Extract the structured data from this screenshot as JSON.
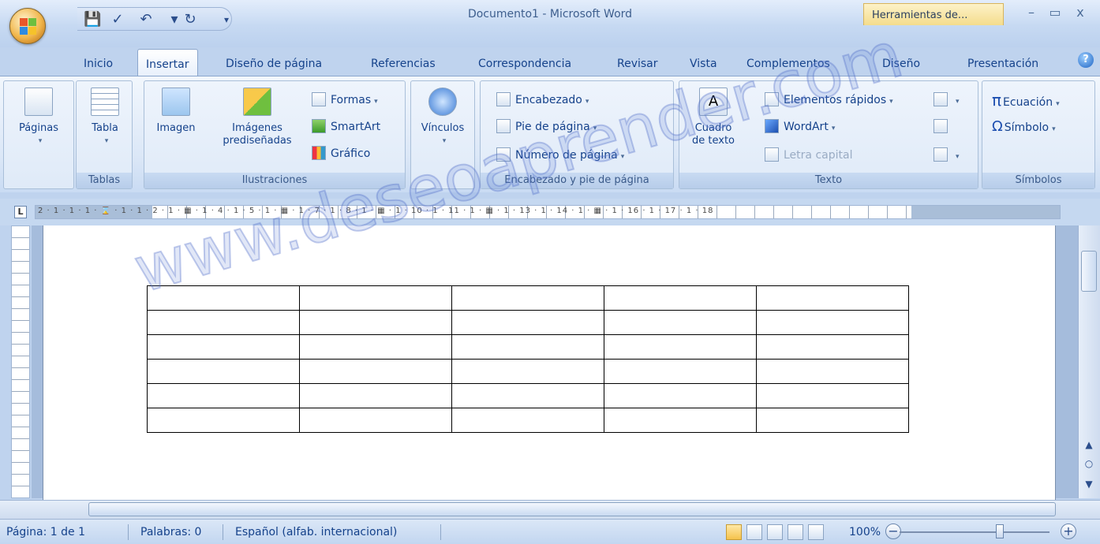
{
  "window": {
    "title": "Documento1 - Microsoft Word",
    "context_tab": "Herramientas de...",
    "controls": {
      "minimize": "–",
      "maximize": "▭",
      "close": "x"
    }
  },
  "qat": {
    "icons": [
      "save-icon",
      "spelling-icon",
      "undo-icon",
      "redo-icon",
      "customize-icon"
    ]
  },
  "tabs": [
    "Inicio",
    "Insertar",
    "Diseño de página",
    "Referencias",
    "Correspondencia",
    "Revisar",
    "Vista",
    "Complementos",
    "Diseño",
    "Presentación"
  ],
  "active_tab": "Insertar",
  "help": "?",
  "ribbon": {
    "paginas": {
      "label": "Páginas"
    },
    "tablas": {
      "label": "Tablas",
      "tabla": "Tabla"
    },
    "ilustraciones": {
      "label": "Ilustraciones",
      "imagen": "Imagen",
      "imagenes_line1": "Imágenes",
      "imagenes_line2": "prediseñadas",
      "formas": "Formas",
      "smartart": "SmartArt",
      "grafico": "Gráfico"
    },
    "vinculos": {
      "label": "Vínculos"
    },
    "encabezado": {
      "label": "Encabezado y pie de página",
      "encabezado": "Encabezado",
      "pie": "Pie de página",
      "numero": "Número de página"
    },
    "texto": {
      "label": "Texto",
      "cuadro_line1": "Cuadro",
      "cuadro_line2": "de texto",
      "elementos": "Elementos rápidos",
      "wordart": "WordArt",
      "letra": "Letra capital"
    },
    "simbolos": {
      "label": "Símbolos",
      "ecuacion": "Ecuación",
      "simbolo": "Símbolo"
    }
  },
  "ruler": {
    "corner": "L",
    "numbers": "2 · 1 · 1 · 1 · ⌛ · 1 · 1 · 2 · 1 · ▦ · 1 · 4 · 1 · 5 · 1 · ▦ · 1 · 7 · 1 · 8 · 1 · ▦ · 1 · 10 · 1 · 11 · 1 · ▦ · 1 · 13 · 1 · 14 · 1 · ▦ · 1 · 16 · 1 · 17 · 1 · 18"
  },
  "document": {
    "table": {
      "rows": 6,
      "cols": 5
    }
  },
  "watermark": "www.deseoaprender.com",
  "status": {
    "page": "Página: 1 de 1",
    "words": "Palabras: 0",
    "language": "Español (alfab. internacional)",
    "zoom": "100%",
    "zoom_minus": "−",
    "zoom_plus": "+"
  }
}
